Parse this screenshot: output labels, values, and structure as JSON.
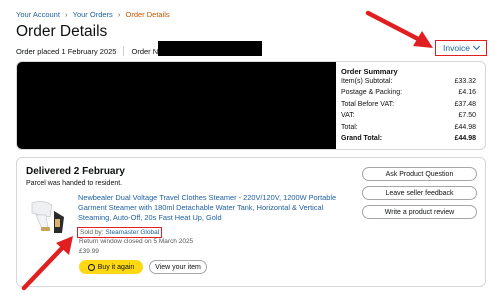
{
  "breadcrumb": {
    "items": [
      "Your Account",
      "Your Orders"
    ],
    "separator": "›",
    "current": "Order Details"
  },
  "page_title": "Order Details",
  "order_meta": {
    "placed": "Order placed 1 February 2025",
    "number_label": "Order No."
  },
  "invoice": {
    "label": "Invoice"
  },
  "order_summary": {
    "title": "Order Summary",
    "rows": [
      {
        "label": "Item(s) Subtotal:",
        "value": "£33.32"
      },
      {
        "label": "Postage & Packing:",
        "value": "£4.16"
      },
      {
        "label": "Total Before VAT:",
        "value": "£37.48"
      },
      {
        "label": "VAT:",
        "value": "£7.50"
      },
      {
        "label": "Total:",
        "value": "£44.98"
      },
      {
        "label": "Grand Total:",
        "value": "£44.98"
      }
    ]
  },
  "delivery": {
    "title": "Delivered 2 February",
    "subtitle": "Parcel was handed to resident."
  },
  "product": {
    "title": "Newbealer Dual Voltage Travel Clothes Steamer - 220V/120V, 1200W Portable Garment Steamer with 180ml Detachable Water Tank, Horizontal & Vertical Steaming, Auto-Off, 20s Fast Heat Up, Gold",
    "sold_by_label": "Sold by:",
    "seller": "Steamaster Global",
    "return_window": "Return window closed on 5 March 2025",
    "price": "£39.99"
  },
  "actions": {
    "buy_again": "Buy it again",
    "view_item": "View your item",
    "ask_question": "Ask Product Question",
    "leave_feedback": "Leave seller feedback",
    "write_review": "Write a product review"
  },
  "colors": {
    "link": "#2162a1",
    "breadcrumb_current": "#c45500",
    "buy_button": "#ffd814",
    "annotation_red": "#e02020"
  }
}
